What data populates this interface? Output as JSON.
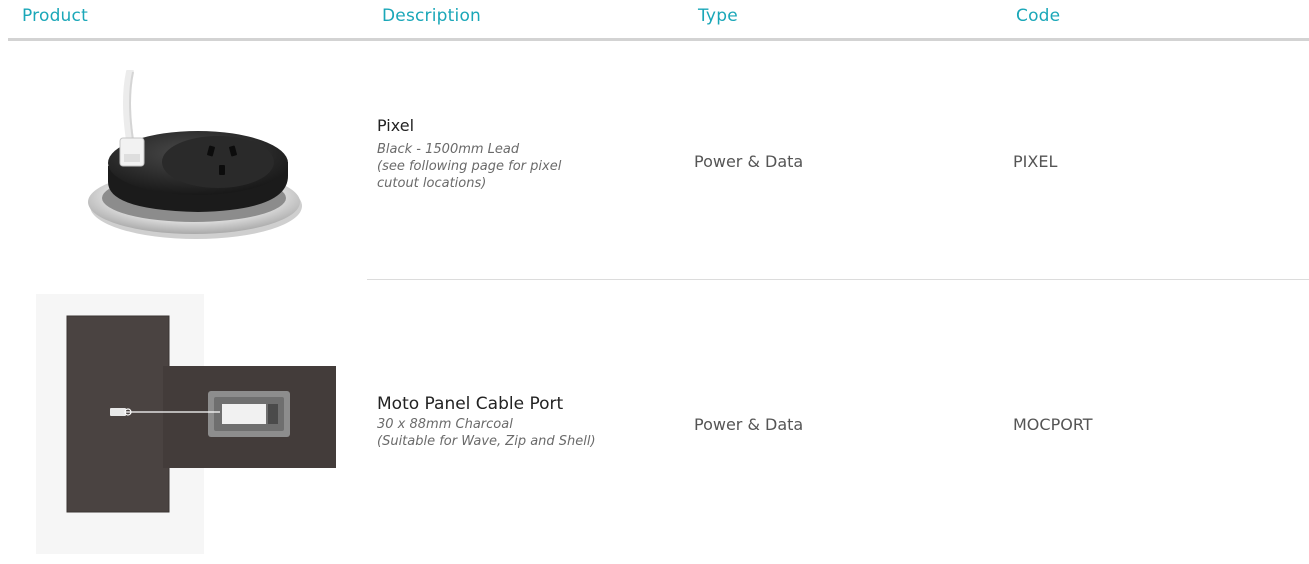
{
  "colors": {
    "accent": "#1aa7b8"
  },
  "header": {
    "product": "Product",
    "description": "Description",
    "type": "Type",
    "code": "Code"
  },
  "rows": [
    {
      "image_icon": "pixel-power-outlet-icon",
      "title": "Pixel",
      "details": [
        "Black - 1500mm Lead",
        "(see following page for pixel",
        "cutout locations)"
      ],
      "type": "Power & Data",
      "code": "PIXEL"
    },
    {
      "image_icon": "moto-panel-cable-port-icon",
      "title": "Moto Panel Cable Port",
      "details": [
        "30 x 88mm Charcoal",
        "(Suitable for Wave, Zip and Shell)"
      ],
      "type": "Power & Data",
      "code": "MOCPORT"
    }
  ]
}
